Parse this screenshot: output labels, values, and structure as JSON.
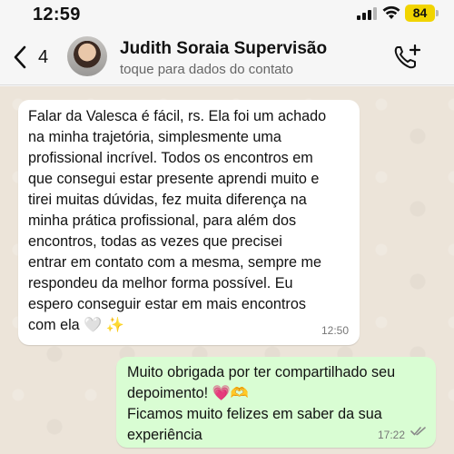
{
  "status": {
    "time": "12:59",
    "battery": "84"
  },
  "header": {
    "back_count": "4",
    "contact_name": "Judith Soraia Supervisão",
    "contact_subtitle": "toque para dados do contato"
  },
  "messages": [
    {
      "direction": "incoming",
      "lines": [
        "Falar da Valesca é fácil, rs. Ela foi um achado",
        "na minha trajetória, simplesmente uma",
        "profissional incrível. Todos os encontros em",
        "que consegui estar presente aprendi muito e",
        "tirei muitas dúvidas, fez muita diferença na",
        "minha prática profissional, para além dos",
        "encontros, todas as vezes que precisei",
        "entrar em contato com a mesma, sempre me",
        "respondeu da melhor forma possível. Eu",
        "espero conseguir estar em mais encontros",
        "com ela 🤍 ✨"
      ],
      "time": "12:50"
    },
    {
      "direction": "outgoing",
      "lines": [
        "Muito obrigada por ter compartilhado seu",
        "depoimento! 💗🫶",
        "Ficamos muito felizes em saber da sua",
        "experiência"
      ],
      "time": "17:22",
      "status": "read"
    }
  ],
  "icons": {
    "back": "chevron-left-icon",
    "call_add": "phone-plus-icon",
    "read": "double-check-icon"
  },
  "colors": {
    "incoming_bubble": "#ffffff",
    "outgoing_bubble": "#d9fdd3",
    "chat_background": "#ece4d9",
    "battery": "#f1d400"
  }
}
